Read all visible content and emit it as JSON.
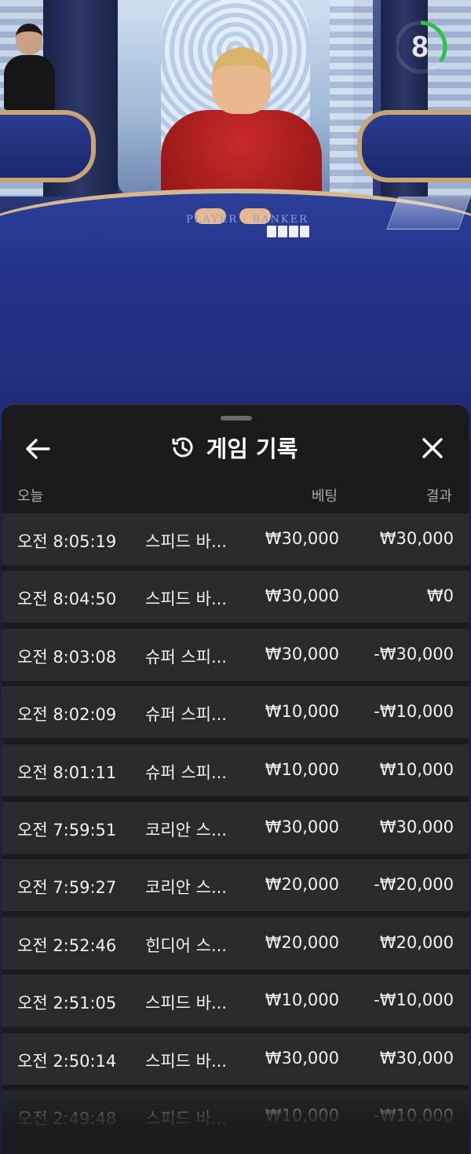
{
  "timer": {
    "value": "8",
    "progress": 0.35,
    "color": "#2fbf4a"
  },
  "header": {
    "title": "게임 기록",
    "back_icon": "arrow-left-icon",
    "history_icon": "history-clock-icon",
    "close_icon": "close-icon"
  },
  "columns": {
    "today": "오늘",
    "bet": "베팅",
    "result": "결과"
  },
  "rows": [
    {
      "time": "오전 8:05:19",
      "game": "스피드 바...",
      "bet": "₩30,000",
      "result": "₩30,000"
    },
    {
      "time": "오전 8:04:50",
      "game": "스피드 바...",
      "bet": "₩30,000",
      "result": "₩0"
    },
    {
      "time": "오전 8:03:08",
      "game": "슈퍼 스피...",
      "bet": "₩30,000",
      "result": "-₩30,000"
    },
    {
      "time": "오전 8:02:09",
      "game": "슈퍼 스피...",
      "bet": "₩10,000",
      "result": "-₩10,000"
    },
    {
      "time": "오전 8:01:11",
      "game": "슈퍼 스피...",
      "bet": "₩10,000",
      "result": "₩10,000"
    },
    {
      "time": "오전 7:59:51",
      "game": "코리안 스...",
      "bet": "₩30,000",
      "result": "₩30,000"
    },
    {
      "time": "오전 7:59:27",
      "game": "코리안 스...",
      "bet": "₩20,000",
      "result": "-₩20,000"
    },
    {
      "time": "오전 2:52:46",
      "game": "힌디어 스...",
      "bet": "₩20,000",
      "result": "₩20,000"
    },
    {
      "time": "오전 2:51:05",
      "game": "스피드 바...",
      "bet": "₩10,000",
      "result": "-₩10,000"
    },
    {
      "time": "오전 2:50:14",
      "game": "스피드 바...",
      "bet": "₩30,000",
      "result": "₩30,000"
    },
    {
      "time": "오전 2:49:48",
      "game": "스피드 바...",
      "bet": "₩10,000",
      "result": "-₩10,000"
    }
  ]
}
